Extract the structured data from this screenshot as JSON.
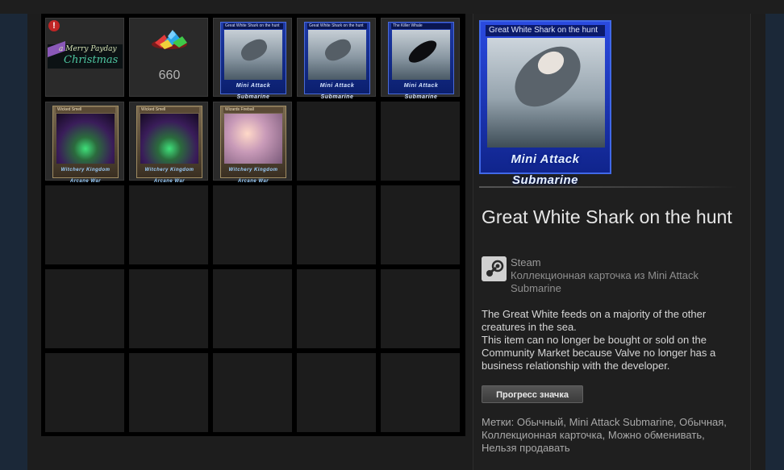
{
  "inventory": {
    "items": [
      {
        "slot": 1,
        "kind": "gift",
        "logo_text_line1": "a Merry Payday",
        "logo_text_line2": "Christmas",
        "alert": "!"
      },
      {
        "slot": 2,
        "kind": "gems",
        "count": "660"
      },
      {
        "slot": 3,
        "kind": "card",
        "card_title": "Great White Shark on the hunt",
        "banner": "Mini Attack Submarine"
      },
      {
        "slot": 4,
        "kind": "card",
        "card_title": "Great White Shark on the hunt",
        "banner": "Mini Attack Submarine"
      },
      {
        "slot": 5,
        "kind": "card",
        "card_title": "The Killer Whale",
        "banner": "Mini Attack Submarine"
      },
      {
        "slot": 6,
        "kind": "card",
        "card_title": "Wicked Smell",
        "banner": "Witchery Kingdom Arcane War"
      },
      {
        "slot": 7,
        "kind": "card",
        "card_title": "Wicked Smell",
        "banner": "Witchery Kingdom Arcane War"
      },
      {
        "slot": 8,
        "kind": "card",
        "card_title": "Wizards Fireball",
        "banner": "Witchery Kingdom Arcane War"
      }
    ]
  },
  "detail": {
    "card_title": "Great White Shark on the hunt",
    "card_banner": "Mini Attack Submarine",
    "item_title": "Great White Shark on the hunt",
    "game_name": "Steam",
    "item_type": "Коллекционная карточка из Mini Attack Submarine",
    "description_line1": "The Great White feeds on a majority of the other creatures in the sea.",
    "description_line2": "This item can no longer be bought or sold on the Community Market because Valve no longer has a business relationship with the developer.",
    "badge_button": "Прогресс значка",
    "tags": "Метки: Обычный, Mini Attack Submarine, Обычная, Коллекционная карточка, Можно обменивать, Нельзя продавать"
  },
  "colors": {
    "card_blue": "#1e3aa8",
    "alert_red": "#c02525",
    "text_light": "#e6e6e6"
  },
  "icons": [
    "alert-icon",
    "gems-icon",
    "steam-icon"
  ]
}
